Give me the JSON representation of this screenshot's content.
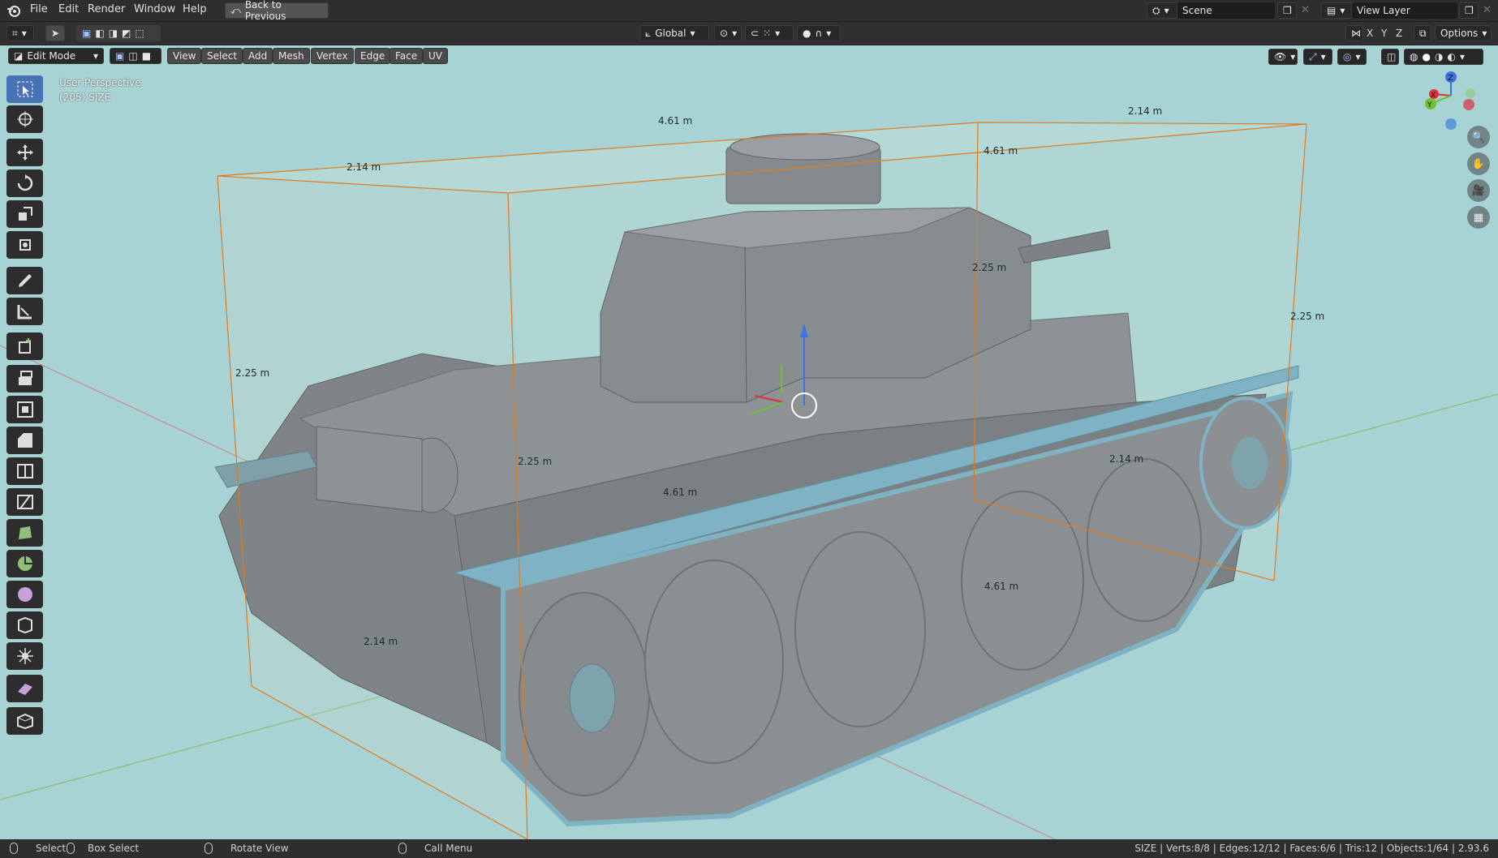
{
  "menubar": {
    "items": [
      "File",
      "Edit",
      "Render",
      "Window",
      "Help"
    ],
    "back_button": "Back to Previous",
    "scene_label": "Scene",
    "view_layer_label": "View Layer"
  },
  "toolbar": {
    "orientation": "Global",
    "axes": [
      "X",
      "Y",
      "Z"
    ],
    "options": "Options"
  },
  "viewport_header": {
    "mode": "Edit Mode",
    "menus": [
      "View",
      "Select",
      "Add",
      "Mesh",
      "Vertex",
      "Edge",
      "Face",
      "UV"
    ]
  },
  "viewport": {
    "view_name": "User Perspective",
    "object_info": "(205) SIZE",
    "measurements": [
      "4.61 m",
      "2.14 m",
      "4.61 m",
      "2.14 m",
      "2.25 m",
      "2.25 m",
      "2.25 m",
      "2.25 m",
      "4.61 m",
      "2.14 m",
      "2.14 m",
      "4.61 m"
    ],
    "gizmo_axes": {
      "x": "X",
      "y": "Y",
      "z": "Z"
    },
    "colors": {
      "background": "#a8d3d5",
      "bounding_box": "#e07a1e",
      "mesh": "#8c9293",
      "selected_edge": "#7fb3c4"
    }
  },
  "statusbar": {
    "select": "Select",
    "box_select": "Box Select",
    "rotate_view": "Rotate View",
    "call_menu": "Call Menu",
    "stats": "SIZE | Verts:8/8 | Edges:12/12 | Faces:6/6 | Tris:12 | Objects:1/64 | 2.93.6"
  }
}
